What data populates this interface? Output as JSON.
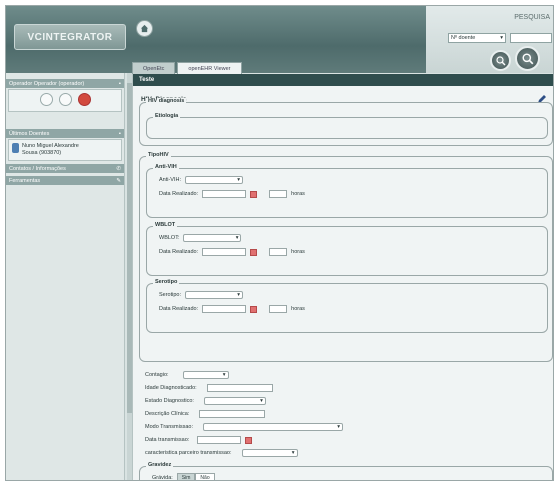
{
  "header": {
    "logo": "VCINTEGRATOR",
    "search_link": "PESQUISA",
    "service_select": "Nº doente",
    "tabs": [
      "OpenEtc",
      "openEHR Viewer"
    ]
  },
  "sidebar": {
    "operator_section": "Operador Operador (operador)",
    "recent_section": "Últimos Doentes",
    "patient": [
      "Nuno Miguel Alexandre",
      "Sousa (903870)"
    ],
    "contacts_section": "Contatos / Informações",
    "tools_section": "Ferramentas"
  },
  "main": {
    "title": "Teste",
    "form_title": "HIV_Diagnosis",
    "hiv_diagnosis_legend": "HIV diagnosis",
    "etiologia": "Etiologia",
    "tipo_hiv_legend": "TipoHIV",
    "groups": [
      {
        "legend": "Anti-VIH",
        "sel_label": "Anti-VIH:",
        "date_label": "Data Realizado:",
        "hours": "horas"
      },
      {
        "legend": "WBLOT",
        "sel_label": "WBLOT:",
        "date_label": "Data Realizado:",
        "hours": "horas"
      },
      {
        "legend": "Serotipo",
        "sel_label": "Serotipo:",
        "date_label": "Data Realizado:",
        "hours": "horas"
      }
    ],
    "fields": {
      "contagio": "Contagio:",
      "idade": "Idade Diagnosticado:",
      "estado": "Estado Diagnostico:",
      "descricao": "Descrição Clínica:",
      "modo": "Modo Transmissao:",
      "data_transmissao": "Data transmissao:",
      "caracteristica": "caracteristica parceiro transmissao:"
    },
    "gravidez_legend": "Gravidez",
    "gravidez_label": "Grávida:",
    "gravidez_options": [
      "Sim",
      "Não"
    ]
  }
}
